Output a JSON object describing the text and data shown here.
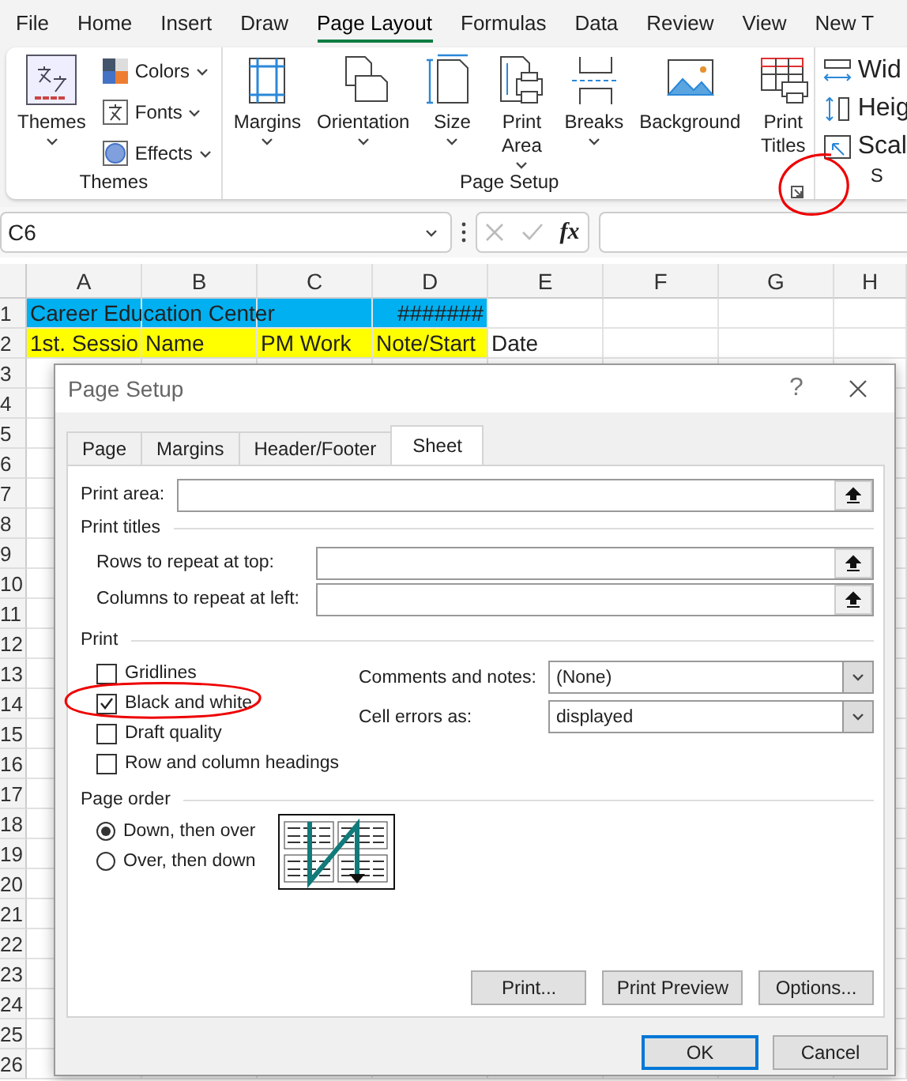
{
  "ribbon_tabs": [
    {
      "label": "File",
      "selected": false
    },
    {
      "label": "Home",
      "selected": false
    },
    {
      "label": "Insert",
      "selected": false
    },
    {
      "label": "Draw",
      "selected": false
    },
    {
      "label": "Page Layout",
      "selected": true
    },
    {
      "label": "Formulas",
      "selected": false
    },
    {
      "label": "Data",
      "selected": false
    },
    {
      "label": "Review",
      "selected": false
    },
    {
      "label": "View",
      "selected": false
    },
    {
      "label": "New T",
      "selected": false
    }
  ],
  "ribbon": {
    "themes_group": {
      "label": "Themes",
      "large": {
        "label": "Themes",
        "dropdown": true
      },
      "small": [
        {
          "label": "Colors",
          "dropdown": true
        },
        {
          "label": "Fonts",
          "dropdown": true
        },
        {
          "label": "Effects",
          "dropdown": true
        }
      ]
    },
    "page_setup_group": {
      "label": "Page Setup",
      "items": [
        {
          "label": "Margins",
          "dropdown": true
        },
        {
          "label": "Orientation",
          "dropdown": true
        },
        {
          "label": "Size",
          "dropdown": true
        },
        {
          "label": "Print Area",
          "dropdown": true
        },
        {
          "label": "Breaks",
          "dropdown": true
        },
        {
          "label": "Background",
          "dropdown": false
        },
        {
          "label": "Print Titles",
          "dropdown": false
        }
      ]
    },
    "scale_group": {
      "label": "S",
      "items": [
        "Wid",
        "Heig",
        "Scal"
      ]
    }
  },
  "formula_bar": {
    "name_box": "C6",
    "function_label": "fx"
  },
  "sheet": {
    "columns": [
      "A",
      "B",
      "C",
      "D",
      "E",
      "F",
      "G",
      "H"
    ],
    "rows": [
      {
        "number": "1",
        "cells": [
          {
            "text": "Career Education Center",
            "color": "#00b0f0"
          },
          {
            "text": "",
            "color": "#00b0f0"
          },
          {
            "text": "",
            "color": "#00b0f0"
          },
          {
            "text": "#######",
            "color": "#00b0f0",
            "right_aligned": true
          }
        ]
      },
      {
        "number": "2",
        "cells": [
          {
            "text": "1st. Sessio",
            "color": "#ffff00"
          },
          {
            "text": "Name",
            "color": "#ffff00"
          },
          {
            "text": "PM Work",
            "color": "#ffff00"
          },
          {
            "text": "Note/Start",
            "color": "#ffff00"
          },
          {
            "text": "Date"
          }
        ]
      },
      {
        "number": "3"
      },
      {
        "number": "4"
      },
      {
        "number": "5"
      },
      {
        "number": "6"
      },
      {
        "number": "7"
      },
      {
        "number": "8"
      },
      {
        "number": "9"
      },
      {
        "number": "10"
      },
      {
        "number": "11"
      },
      {
        "number": "12"
      },
      {
        "number": "13"
      },
      {
        "number": "14"
      },
      {
        "number": "15"
      },
      {
        "number": "16"
      },
      {
        "number": "17"
      },
      {
        "number": "18"
      },
      {
        "number": "19"
      },
      {
        "number": "20"
      },
      {
        "number": "21"
      },
      {
        "number": "22"
      },
      {
        "number": "23"
      },
      {
        "number": "24"
      },
      {
        "number": "25"
      },
      {
        "number": "26"
      }
    ]
  },
  "dialog": {
    "title": "Page Setup",
    "help_button": "?",
    "tabs": [
      {
        "label": "Page",
        "selected": false
      },
      {
        "label": "Margins",
        "selected": false
      },
      {
        "label": "Header/Footer",
        "selected": false
      },
      {
        "label": "Sheet",
        "selected": true
      }
    ],
    "print_area": {
      "label": "Print area:"
    },
    "print_titles": {
      "label": "Print titles",
      "fields": [
        {
          "label": "Rows to repeat at top:"
        },
        {
          "label": "Columns to repeat at left:"
        }
      ]
    },
    "print": {
      "label": "Print",
      "checkboxes": [
        {
          "label": "Gridlines",
          "checked": false
        },
        {
          "label": "Black and white",
          "checked": true
        },
        {
          "label": "Draft quality",
          "checked": false
        },
        {
          "label": "Row and column headings",
          "checked": false
        }
      ],
      "dropdowns": [
        {
          "label": "Comments and notes:",
          "value": "(None)"
        },
        {
          "label": "Cell errors as:",
          "value": "displayed"
        }
      ]
    },
    "page_order": {
      "label": "Page order",
      "options": [
        {
          "label": "Down, then over",
          "selected": true
        },
        {
          "label": "Over, then down",
          "selected": false
        }
      ]
    },
    "buttons": [
      "Print...",
      "Print Preview",
      "Options..."
    ],
    "footer_buttons": [
      {
        "label": "OK",
        "default": true
      },
      {
        "label": "Cancel",
        "default": false
      }
    ]
  }
}
